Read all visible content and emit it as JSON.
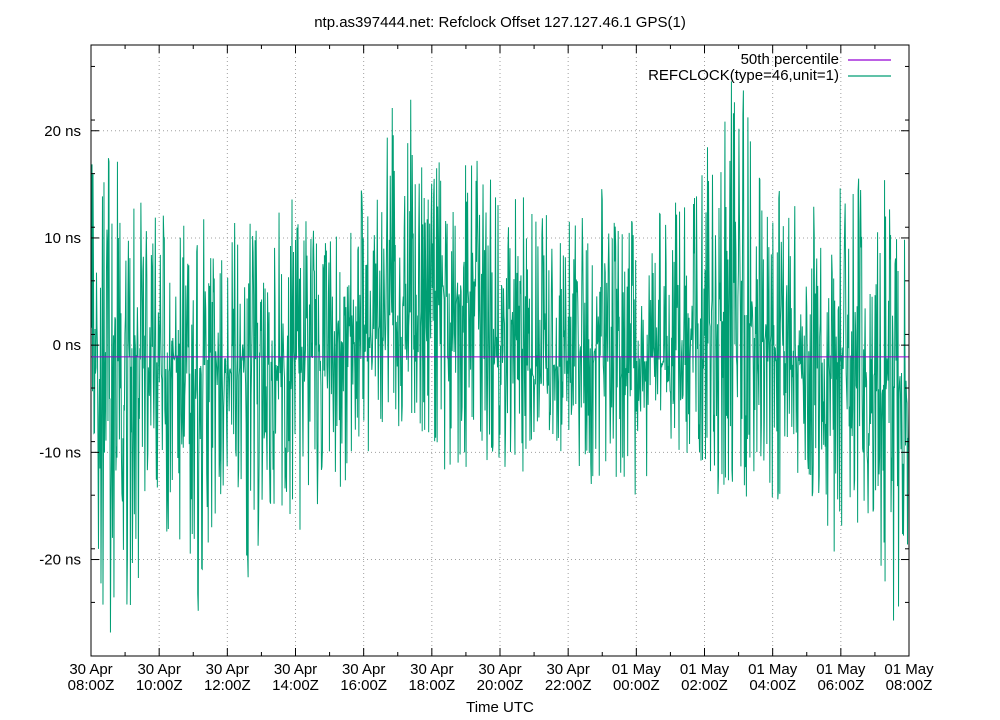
{
  "chart_data": {
    "type": "line",
    "title": "ntp.as397444.net: Refclock Offset 127.127.46.1 GPS(1)",
    "xlabel": "Time UTC",
    "ylabel": "",
    "ylim": [
      -29,
      28
    ],
    "y_ticks": [
      {
        "value": 20,
        "label": "20 ns"
      },
      {
        "value": 10,
        "label": "10 ns"
      },
      {
        "value": 0,
        "label": "0 ns"
      },
      {
        "value": -10,
        "label": "-10 ns"
      },
      {
        "value": -20,
        "label": "-20 ns"
      }
    ],
    "x_range_hours": [
      0,
      24
    ],
    "x_ticks": [
      {
        "hour": 0,
        "line1": "30 Apr",
        "line2": "08:00Z"
      },
      {
        "hour": 2,
        "line1": "30 Apr",
        "line2": "10:00Z"
      },
      {
        "hour": 4,
        "line1": "30 Apr",
        "line2": "12:00Z"
      },
      {
        "hour": 6,
        "line1": "30 Apr",
        "line2": "14:00Z"
      },
      {
        "hour": 8,
        "line1": "30 Apr",
        "line2": "16:00Z"
      },
      {
        "hour": 10,
        "line1": "30 Apr",
        "line2": "18:00Z"
      },
      {
        "hour": 12,
        "line1": "30 Apr",
        "line2": "20:00Z"
      },
      {
        "hour": 14,
        "line1": "30 Apr",
        "line2": "22:00Z"
      },
      {
        "hour": 16,
        "line1": "01 May",
        "line2": "00:00Z"
      },
      {
        "hour": 18,
        "line1": "01 May",
        "line2": "02:00Z"
      },
      {
        "hour": 20,
        "line1": "01 May",
        "line2": "04:00Z"
      },
      {
        "hour": 22,
        "line1": "01 May",
        "line2": "06:00Z"
      },
      {
        "hour": 24,
        "line1": "01 May",
        "line2": "08:00Z"
      }
    ],
    "grid": true,
    "legend_position": "top-right",
    "series": [
      {
        "name": "50th percentile",
        "color": "#9400d3",
        "constant_value": -1.1
      },
      {
        "name": "REFCLOCK(type=46,unit=1)",
        "color": "#009e73",
        "x_hours": [
          0,
          0.5,
          1,
          1.5,
          2,
          2.5,
          3,
          3.5,
          4,
          4.5,
          5,
          5.5,
          6,
          6.5,
          7,
          7.5,
          8,
          8.5,
          9,
          9.5,
          10,
          10.5,
          11,
          11.5,
          12,
          12.5,
          13,
          13.5,
          14,
          14.5,
          15,
          15.5,
          16,
          16.5,
          17,
          17.5,
          18,
          18.5,
          19,
          19.5,
          20,
          20.5,
          21,
          21.5,
          22,
          22.5,
          23,
          23.5,
          24
        ],
        "band_min": [
          -18,
          -27,
          -26,
          -22,
          -20,
          -16,
          -28,
          -20,
          -18,
          -23,
          -18,
          -15,
          -19,
          -16,
          -12,
          -14,
          -11,
          -9,
          -8,
          -7,
          -12,
          -14,
          -15,
          -13,
          -11,
          -15,
          -9,
          -12,
          -10,
          -13,
          -14,
          -12,
          -15,
          -11,
          -10,
          -11,
          -13,
          -15,
          -13,
          -16,
          -17,
          -12,
          -14,
          -19,
          -20,
          -17,
          -18,
          -26,
          -29
        ],
        "band_max": [
          19,
          18,
          18,
          13,
          15,
          10,
          18,
          12,
          12,
          12,
          11,
          13,
          14,
          12,
          10,
          13,
          16,
          18,
          26,
          22,
          17,
          19,
          17,
          18,
          14,
          14,
          16,
          11,
          14,
          13,
          15,
          12,
          12,
          13,
          12,
          17,
          20,
          22,
          28,
          18,
          15,
          14,
          16,
          14,
          16,
          18,
          17,
          15,
          12
        ],
        "median": [
          3,
          -4,
          1,
          -2,
          -3,
          -1,
          -5,
          0,
          -3,
          -2,
          -1,
          -2,
          -3,
          -1,
          -2,
          1,
          0,
          2,
          4,
          3,
          3,
          5,
          4,
          4,
          0,
          1,
          -3,
          -2,
          -2,
          0,
          -1,
          -3,
          -2,
          -1,
          -2,
          0,
          2,
          4,
          4,
          1,
          0,
          -2,
          -1,
          -2,
          -3,
          -2,
          -4,
          -3,
          -9
        ]
      }
    ]
  }
}
